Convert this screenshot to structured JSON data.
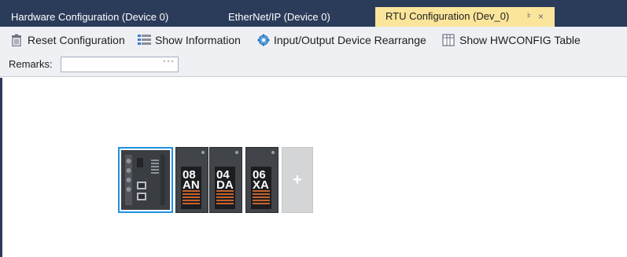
{
  "tabs": [
    {
      "label": "Hardware Configuration (Device 0)",
      "active": false
    },
    {
      "label": "EtherNet/IP (Device 0)",
      "active": false
    },
    {
      "label": "RTU Configuration (Dev_0)",
      "active": true,
      "pin_glyph": "⊧",
      "close_glyph": "×"
    }
  ],
  "toolbar": {
    "reset_label": "Reset Configuration",
    "info_label": "Show Information",
    "rearrange_label": "Input/Output Device Rearrange",
    "hwconfig_label": "Show HWCONFIG Table"
  },
  "remarks": {
    "label": "Remarks:",
    "value": "",
    "ellipsis": "···"
  },
  "modules": [
    {
      "type": "cpu"
    },
    {
      "code": "08 AN"
    },
    {
      "code": "04 DA"
    },
    {
      "code": "06 XA"
    }
  ],
  "add_slot": {
    "glyph": "+"
  },
  "colors": {
    "tab_bar": "#2b3b5a",
    "active_tab": "#fbe59a",
    "toolbar_bg": "#eef0f4",
    "selection": "#1e90e0",
    "module_body": "#414449"
  }
}
